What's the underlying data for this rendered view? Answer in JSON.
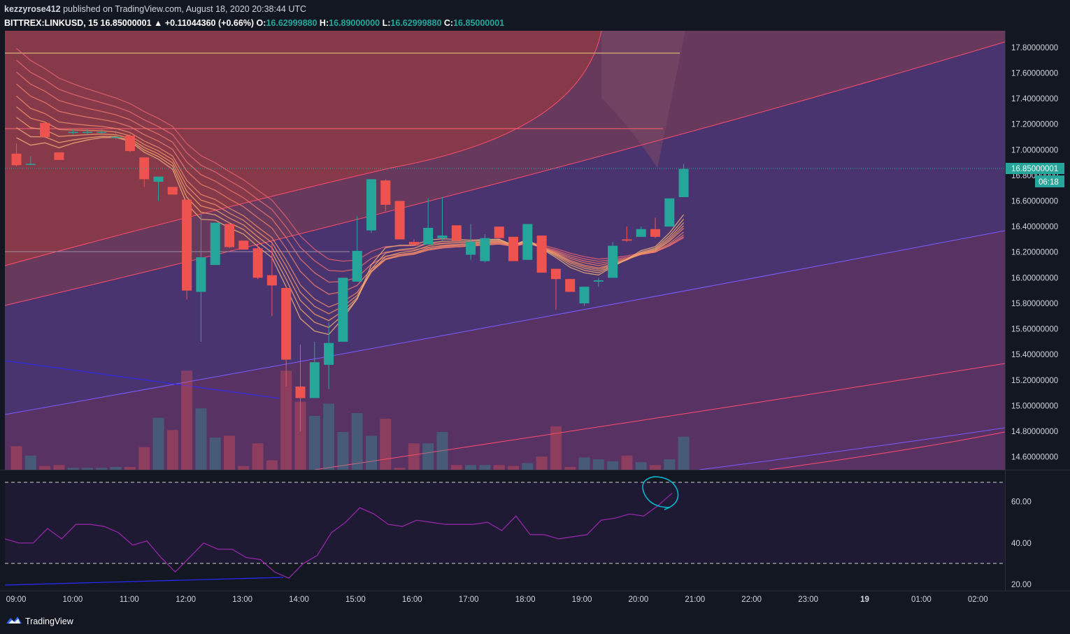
{
  "header": {
    "user": "kezzyrose412",
    "published_text": "published on TradingView.com, August 18, 2020 20:38:44 UTC",
    "symbol": "BITTREX:LINKUSD, 15",
    "last": "16.85000001",
    "change": "▲ +0.11044360 (+0.66%)",
    "o_label": "O:",
    "o": "16.62999880",
    "h_label": "H:",
    "h": "16.89000000",
    "l_label": "L:",
    "l": "16.62999880",
    "c_label": "C:",
    "c": "16.85000001"
  },
  "price_badge": {
    "value": "16.85000001",
    "countdown": "06:18"
  },
  "footer": {
    "brand": "TradingView"
  },
  "colors": {
    "up": "#26a69a",
    "down": "#ef5350",
    "bg": "#131722",
    "rsi": "#9c27b0",
    "annotation": "#00bcd4"
  },
  "chart_data": [
    {
      "type": "candlestick",
      "ylim": [
        14.5,
        17.93
      ],
      "y_ticks": [
        "17.80000000",
        "17.60000000",
        "17.40000000",
        "17.20000000",
        "17.00000000",
        "16.80000000",
        "16.60000000",
        "16.40000000",
        "16.20000000",
        "16.00000000",
        "15.80000000",
        "15.60000000",
        "15.40000000",
        "15.20000000",
        "15.00000000",
        "14.80000000",
        "14.60000000"
      ],
      "x_ticks": [
        "09:00",
        "10:00",
        "11:00",
        "12:00",
        "13:00",
        "14:00",
        "15:00",
        "16:00",
        "17:00",
        "18:00",
        "19:00",
        "20:00",
        "21:00",
        "22:00",
        "23:00",
        "19",
        "01:00",
        "02:00"
      ],
      "candles": [
        {
          "t": "08:45",
          "o": 16.97,
          "h": 17.05,
          "l": 16.87,
          "c": 16.88
        },
        {
          "t": "09:00",
          "o": 16.89,
          "h": 16.95,
          "l": 16.88,
          "c": 16.89
        },
        {
          "t": "09:15",
          "o": 17.21,
          "h": 17.22,
          "l": 17.1,
          "c": 17.1
        },
        {
          "t": "09:30",
          "o": 16.98,
          "h": 16.98,
          "l": 16.92,
          "c": 16.92
        },
        {
          "t": "09:45",
          "o": 17.14,
          "h": 17.16,
          "l": 17.12,
          "c": 17.14
        },
        {
          "t": "10:00",
          "o": 17.14,
          "h": 17.16,
          "l": 17.12,
          "c": 17.14
        },
        {
          "t": "10:15",
          "o": 17.14,
          "h": 17.16,
          "l": 17.12,
          "c": 17.14
        },
        {
          "t": "10:30",
          "o": 17.1,
          "h": 17.15,
          "l": 17.08,
          "c": 17.1
        },
        {
          "t": "10:45",
          "o": 17.11,
          "h": 17.12,
          "l": 16.98,
          "c": 16.99
        },
        {
          "t": "11:00",
          "o": 16.94,
          "h": 16.94,
          "l": 16.71,
          "c": 16.77
        },
        {
          "t": "11:15",
          "o": 16.75,
          "h": 16.79,
          "l": 16.6,
          "c": 16.79
        },
        {
          "t": "11:30",
          "o": 16.71,
          "h": 16.71,
          "l": 16.65,
          "c": 16.65
        },
        {
          "t": "11:45",
          "o": 16.61,
          "h": 16.61,
          "l": 15.83,
          "c": 15.9
        },
        {
          "t": "12:00",
          "o": 15.89,
          "h": 16.5,
          "l": 15.5,
          "c": 16.16
        },
        {
          "t": "12:15",
          "o": 16.1,
          "h": 16.43,
          "l": 16.1,
          "c": 16.43
        },
        {
          "t": "12:30",
          "o": 16.42,
          "h": 16.43,
          "l": 16.23,
          "c": 16.24
        },
        {
          "t": "12:45",
          "o": 16.29,
          "h": 16.29,
          "l": 16.22,
          "c": 16.22
        },
        {
          "t": "13:00",
          "o": 16.23,
          "h": 16.26,
          "l": 15.99,
          "c": 16.0
        },
        {
          "t": "13:15",
          "o": 16.02,
          "h": 16.27,
          "l": 15.7,
          "c": 15.94
        },
        {
          "t": "13:30",
          "o": 15.92,
          "h": 15.93,
          "l": 15.15,
          "c": 15.36
        },
        {
          "t": "13:45",
          "o": 15.15,
          "h": 15.48,
          "l": 14.8,
          "c": 15.06
        },
        {
          "t": "14:00",
          "o": 15.06,
          "h": 15.5,
          "l": 15.06,
          "c": 15.34
        },
        {
          "t": "14:15",
          "o": 15.32,
          "h": 15.65,
          "l": 15.13,
          "c": 15.49
        },
        {
          "t": "14:30",
          "o": 15.5,
          "h": 16.0,
          "l": 15.5,
          "c": 16.0
        },
        {
          "t": "14:45",
          "o": 15.97,
          "h": 16.48,
          "l": 15.97,
          "c": 16.21
        },
        {
          "t": "15:00",
          "o": 16.37,
          "h": 16.77,
          "l": 16.35,
          "c": 16.77
        },
        {
          "t": "15:15",
          "o": 16.76,
          "h": 16.77,
          "l": 16.52,
          "c": 16.57
        },
        {
          "t": "15:30",
          "o": 16.6,
          "h": 16.6,
          "l": 16.3,
          "c": 16.3
        },
        {
          "t": "15:45",
          "o": 16.28,
          "h": 16.3,
          "l": 16.25,
          "c": 16.26
        },
        {
          "t": "16:00",
          "o": 16.26,
          "h": 16.62,
          "l": 16.26,
          "c": 16.39
        },
        {
          "t": "16:15",
          "o": 16.31,
          "h": 16.63,
          "l": 16.29,
          "c": 16.33
        },
        {
          "t": "16:30",
          "o": 16.41,
          "h": 16.41,
          "l": 16.28,
          "c": 16.29
        },
        {
          "t": "16:45",
          "o": 16.18,
          "h": 16.42,
          "l": 16.14,
          "c": 16.28
        },
        {
          "t": "17:00",
          "o": 16.13,
          "h": 16.34,
          "l": 16.12,
          "c": 16.31
        },
        {
          "t": "17:15",
          "o": 16.4,
          "h": 16.4,
          "l": 16.31,
          "c": 16.31
        },
        {
          "t": "17:30",
          "o": 16.32,
          "h": 16.32,
          "l": 16.13,
          "c": 16.13
        },
        {
          "t": "17:45",
          "o": 16.14,
          "h": 16.42,
          "l": 16.14,
          "c": 16.42
        },
        {
          "t": "18:00",
          "o": 16.33,
          "h": 16.33,
          "l": 16.04,
          "c": 16.04
        },
        {
          "t": "18:15",
          "o": 16.07,
          "h": 16.07,
          "l": 15.75,
          "c": 15.99
        },
        {
          "t": "18:30",
          "o": 15.99,
          "h": 15.99,
          "l": 15.89,
          "c": 15.89
        },
        {
          "t": "18:45",
          "o": 15.8,
          "h": 15.93,
          "l": 15.78,
          "c": 15.93
        },
        {
          "t": "19:00",
          "o": 15.97,
          "h": 16.0,
          "l": 15.93,
          "c": 15.98
        },
        {
          "t": "19:15",
          "o": 16.0,
          "h": 16.28,
          "l": 16.0,
          "c": 16.25
        },
        {
          "t": "19:30",
          "o": 16.3,
          "h": 16.4,
          "l": 16.28,
          "c": 16.29
        },
        {
          "t": "19:45",
          "o": 16.32,
          "h": 16.4,
          "l": 16.32,
          "c": 16.38
        },
        {
          "t": "20:00",
          "o": 16.38,
          "h": 16.47,
          "l": 16.31,
          "c": 16.32
        },
        {
          "t": "20:15",
          "o": 16.4,
          "h": 16.62,
          "l": 16.4,
          "c": 16.62
        },
        {
          "t": "20:30",
          "o": 16.63,
          "h": 16.89,
          "l": 16.63,
          "c": 16.85
        }
      ],
      "volume": [
        0.25,
        0.15,
        0.04,
        0.05,
        0.02,
        0.02,
        0.02,
        0.03,
        0.03,
        0.24,
        0.55,
        0.42,
        1.05,
        0.65,
        0.34,
        0.36,
        0.04,
        0.28,
        0.1,
        1.05,
        0.72,
        0.57,
        0.7,
        0.4,
        0.6,
        0.36,
        0.54,
        0.02,
        0.28,
        0.28,
        0.4,
        0.05,
        0.05,
        0.05,
        0.05,
        0.04,
        0.07,
        0.14,
        0.46,
        0.03,
        0.13,
        0.11,
        0.09,
        0.15,
        0.08,
        0.05,
        0.11,
        0.35
      ]
    },
    {
      "type": "line",
      "name": "RSI",
      "ylim": [
        17,
        75
      ],
      "y_ticks": [
        "60.00",
        "40.00",
        "20.00"
      ],
      "levels": [
        70,
        30
      ],
      "values": [
        42,
        40,
        40,
        47,
        42,
        49,
        49,
        48,
        45,
        39,
        41,
        33,
        26,
        33,
        40,
        37,
        37,
        33,
        32,
        26,
        23,
        30,
        34,
        45,
        50,
        57,
        54,
        49,
        48,
        51,
        50,
        49,
        49,
        49,
        50,
        46,
        53,
        44,
        44,
        42,
        43,
        44,
        51,
        52,
        54,
        53,
        58,
        64
      ]
    }
  ]
}
